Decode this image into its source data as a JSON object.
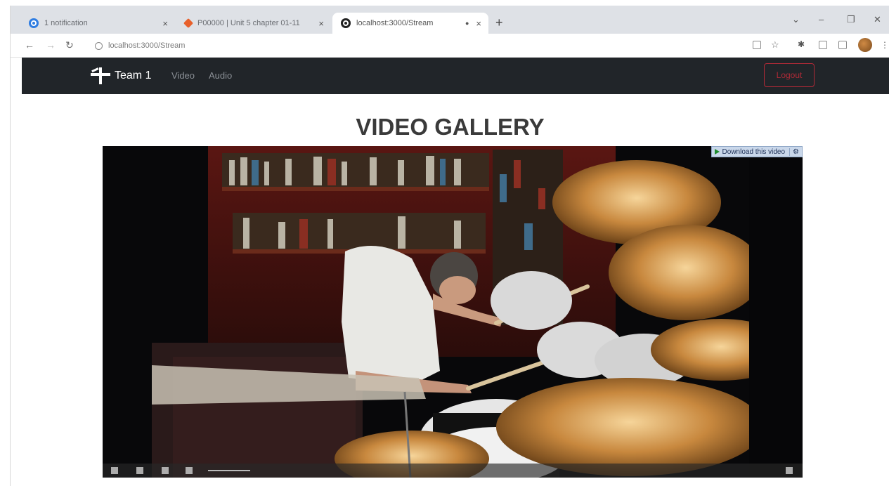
{
  "browser": {
    "tabs": [
      {
        "title": "1 notification",
        "close": "×"
      },
      {
        "title": "P00000 | Unit 5 chapter 01-11",
        "close": "×"
      },
      {
        "title": "localhost:3000/Stream",
        "close": "×"
      }
    ],
    "new_tab": "+",
    "address": "localhost:3000/Stream",
    "window_controls": [
      "⌄",
      "–",
      "❐",
      "✕"
    ]
  },
  "app": {
    "brand": "Team 1",
    "nav": [
      {
        "label": "Video"
      },
      {
        "label": "Audio"
      }
    ],
    "logout_label": "Logout"
  },
  "page": {
    "heading": "VIDEO GALLERY"
  },
  "video": {
    "download_label": "Download this video"
  },
  "colors": {
    "navbar_bg": "#212529",
    "logout_accent": "#b02a37"
  }
}
